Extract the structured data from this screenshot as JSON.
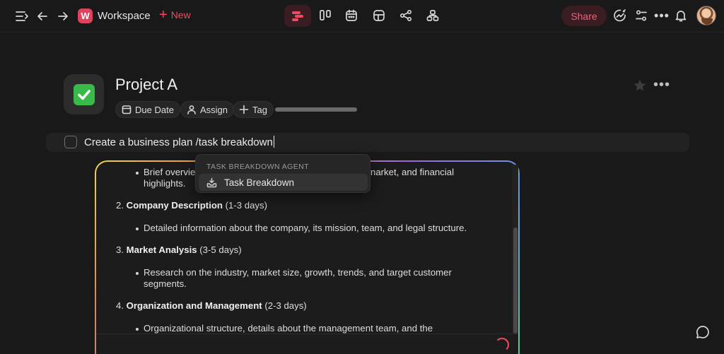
{
  "topbar": {
    "workspace_badge": "W",
    "workspace_name": "Workspace",
    "new_label": "New",
    "share_label": "Share",
    "view_icons": [
      "timeline-icon",
      "board-icon",
      "calendar-icon",
      "table-icon",
      "mindmap-icon",
      "hierarchy-icon"
    ],
    "accent_color": "#ef4a61"
  },
  "project": {
    "title": "Project A",
    "chips": [
      {
        "label": "Due Date",
        "icon": "calendar-icon"
      },
      {
        "label": "Assign",
        "icon": "person-icon"
      },
      {
        "label": "Tag",
        "icon": "plus-icon"
      }
    ],
    "progress_fraction": 1.0
  },
  "task": {
    "text": "Create a business plan /task breakdown"
  },
  "dropdown": {
    "heading": "TASK BREAKDOWN AGENT",
    "item_label": "Task Breakdown"
  },
  "ai_panel": {
    "bullet_1a": "Brief overvie",
    "bullet_1b": "narket, and financial",
    "bullet_1c": "highlights.",
    "item_2_num": "2.",
    "item_2_title": "Company Description",
    "item_2_duration": "(1-3 days)",
    "bullet_2": "Detailed information about the company, its mission, team, and legal structure.",
    "item_3_num": "3.",
    "item_3_title": "Market Analysis",
    "item_3_duration": "(3-5 days)",
    "bullet_3a": "Research on the industry, market size, growth, trends, and target customer",
    "bullet_3b": "segments.",
    "item_4_num": "4.",
    "item_4_title": "Organization and Management",
    "item_4_duration": "(2-3 days)",
    "bullet_4": "Organizational structure, details about the management team, and the"
  }
}
